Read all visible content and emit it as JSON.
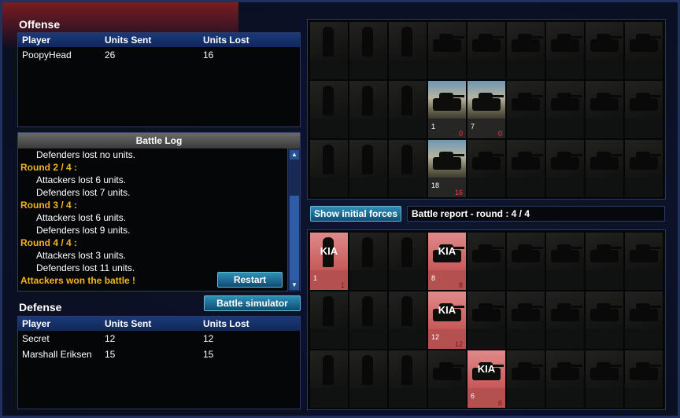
{
  "offense": {
    "title": "Offense",
    "headers": [
      "Player",
      "Units Sent",
      "Units Lost"
    ],
    "rows": [
      {
        "player": "PoopyHead",
        "sent": "26",
        "lost": "16"
      }
    ]
  },
  "battle_log": {
    "title": "Battle Log",
    "lines": [
      {
        "kind": "sub",
        "text": "Defenders lost no units."
      },
      {
        "kind": "round",
        "text": "Round 2 / 4 :"
      },
      {
        "kind": "sub",
        "text": "Attackers lost 6 units."
      },
      {
        "kind": "sub",
        "text": "Defenders lost 7 units."
      },
      {
        "kind": "round",
        "text": "Round 3 / 4 :"
      },
      {
        "kind": "sub",
        "text": "Attackers lost 6 units."
      },
      {
        "kind": "sub",
        "text": "Defenders lost 9 units."
      },
      {
        "kind": "round",
        "text": "Round 4 / 4 :"
      },
      {
        "kind": "sub",
        "text": "Attackers lost 3 units."
      },
      {
        "kind": "sub",
        "text": "Defenders lost 11 units."
      },
      {
        "kind": "won",
        "text": "Attackers won the battle !"
      }
    ],
    "restart_label": "Restart",
    "scroll_up_icon": "arrow-up-icon",
    "scroll_down_icon": "arrow-down-icon"
  },
  "defense": {
    "title": "Defense",
    "headers": [
      "Player",
      "Units Sent",
      "Units Lost"
    ],
    "rows": [
      {
        "player": "Secret",
        "sent": "12",
        "lost": "12"
      },
      {
        "player": "Marshall Eriksen",
        "sent": "15",
        "lost": "15"
      }
    ]
  },
  "buttons": {
    "battle_simulator": "Battle simulator",
    "show_initial_forces": "Show initial forces"
  },
  "report": {
    "label": "Battle report - round : 4 / 4"
  },
  "top_grid": {
    "cells": [
      [
        {
          "type": "soldier"
        },
        {
          "type": "soldier"
        },
        {
          "type": "soldier"
        },
        {
          "type": "vehicle"
        },
        {
          "type": "vehicle"
        },
        {
          "type": "vehicle"
        },
        {
          "type": "vehicle"
        },
        {
          "type": "vehicle"
        },
        {
          "type": "vehicle"
        }
      ],
      [
        {
          "type": "soldier"
        },
        {
          "type": "soldier"
        },
        {
          "type": "soldier"
        },
        {
          "type": "vehicle",
          "state": "active",
          "count": "1",
          "lost": "0"
        },
        {
          "type": "vehicle",
          "state": "active",
          "count": "7",
          "lost": "0"
        },
        {
          "type": "vehicle"
        },
        {
          "type": "vehicle"
        },
        {
          "type": "vehicle"
        },
        {
          "type": "vehicle"
        }
      ],
      [
        {
          "type": "soldier"
        },
        {
          "type": "soldier"
        },
        {
          "type": "soldier"
        },
        {
          "type": "vehicle",
          "state": "active",
          "count": "18",
          "lost": "16"
        },
        {
          "type": "vehicle"
        },
        {
          "type": "vehicle"
        },
        {
          "type": "vehicle"
        },
        {
          "type": "vehicle"
        },
        {
          "type": "vehicle"
        }
      ]
    ]
  },
  "bottom_grid": {
    "kia_label": "KIA",
    "cells": [
      [
        {
          "type": "soldier",
          "state": "kia",
          "count": "1",
          "lost": "1"
        },
        {
          "type": "soldier"
        },
        {
          "type": "soldier"
        },
        {
          "type": "vehicle",
          "state": "kia",
          "count": "8",
          "lost": "8"
        },
        {
          "type": "vehicle"
        },
        {
          "type": "vehicle"
        },
        {
          "type": "vehicle"
        },
        {
          "type": "vehicle"
        },
        {
          "type": "vehicle"
        }
      ],
      [
        {
          "type": "soldier"
        },
        {
          "type": "soldier"
        },
        {
          "type": "soldier"
        },
        {
          "type": "vehicle",
          "state": "kia",
          "count": "12",
          "lost": "12"
        },
        {
          "type": "vehicle"
        },
        {
          "type": "vehicle"
        },
        {
          "type": "vehicle"
        },
        {
          "type": "vehicle"
        },
        {
          "type": "vehicle"
        }
      ],
      [
        {
          "type": "soldier"
        },
        {
          "type": "soldier"
        },
        {
          "type": "soldier"
        },
        {
          "type": "vehicle"
        },
        {
          "type": "vehicle",
          "state": "kia",
          "count": "6",
          "lost": "6"
        },
        {
          "type": "vehicle"
        },
        {
          "type": "vehicle"
        },
        {
          "type": "vehicle"
        },
        {
          "type": "vehicle"
        }
      ]
    ]
  }
}
